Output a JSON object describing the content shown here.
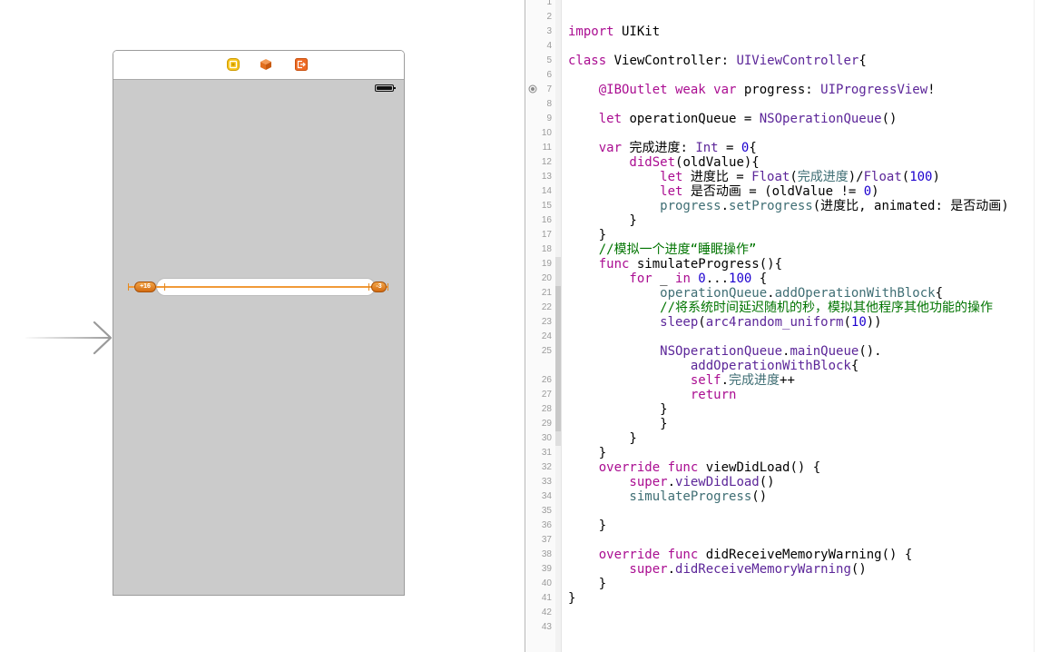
{
  "canvas": {
    "scene": {
      "dock_icons": [
        "view-controller-icon",
        "first-responder-icon",
        "exit-icon"
      ],
      "status_bar_icon": "battery-icon",
      "constraints": {
        "leading": "+16",
        "trailing": "-3"
      }
    },
    "entry_point_icon": "initial-view-controller-arrow"
  },
  "editor": {
    "outlet_indicator_icon": "outlet-connected-icon",
    "rows": [
      {
        "n": "1"
      },
      {
        "n": "2"
      },
      {
        "n": "3",
        "tk": [
          {
            "t": "import",
            "c": "#AA0D91"
          },
          {
            "t": " UIKit"
          }
        ]
      },
      {
        "n": "4"
      },
      {
        "n": "5",
        "tk": [
          {
            "t": "class",
            "c": "#AA0D91"
          },
          {
            "t": " ViewController: "
          },
          {
            "t": "UIViewController",
            "c": "#5C2699"
          },
          {
            "t": "{"
          }
        ]
      },
      {
        "n": "6"
      },
      {
        "n": "7",
        "tk": [
          {
            "t": "    @IBOutlet weak var",
            "c": "#AA0D91"
          },
          {
            "t": " progress: "
          },
          {
            "t": "UIProgressView",
            "c": "#5C2699"
          },
          {
            "t": "!"
          }
        ]
      },
      {
        "n": "8"
      },
      {
        "n": "9",
        "tk": [
          {
            "t": "    let",
            "c": "#AA0D91"
          },
          {
            "t": " operationQueue = "
          },
          {
            "t": "NSOperationQueue",
            "c": "#5C2699"
          },
          {
            "t": "()"
          }
        ]
      },
      {
        "n": "10"
      },
      {
        "n": "11",
        "tk": [
          {
            "t": "    var",
            "c": "#AA0D91"
          },
          {
            "t": " 完成进度: "
          },
          {
            "t": "Int",
            "c": "#5C2699"
          },
          {
            "t": " = "
          },
          {
            "t": "0",
            "c": "#1C00CF"
          },
          {
            "t": "{"
          }
        ]
      },
      {
        "n": "12",
        "tk": [
          {
            "t": "        didSet",
            "c": "#AA0D91"
          },
          {
            "t": "(oldValue){"
          }
        ]
      },
      {
        "n": "13",
        "tk": [
          {
            "t": "            let",
            "c": "#AA0D91"
          },
          {
            "t": " 进度比 = "
          },
          {
            "t": "Float",
            "c": "#5C2699"
          },
          {
            "t": "("
          },
          {
            "t": "完成进度",
            "c": "#3F6E74"
          },
          {
            "t": ")/"
          },
          {
            "t": "Float",
            "c": "#5C2699"
          },
          {
            "t": "("
          },
          {
            "t": "100",
            "c": "#1C00CF"
          },
          {
            "t": ")"
          }
        ]
      },
      {
        "n": "14",
        "tk": [
          {
            "t": "            let",
            "c": "#AA0D91"
          },
          {
            "t": " 是否动画 = (oldValue != "
          },
          {
            "t": "0",
            "c": "#1C00CF"
          },
          {
            "t": ")"
          }
        ]
      },
      {
        "n": "15",
        "tk": [
          {
            "t": "            progress",
            "c": "#3F6E74"
          },
          {
            "t": "."
          },
          {
            "t": "setProgress",
            "c": "#3F6E74"
          },
          {
            "t": "(进度比, animated: 是否动画)"
          }
        ]
      },
      {
        "n": "16",
        "tk": [
          {
            "t": "        }"
          }
        ]
      },
      {
        "n": "17",
        "tk": [
          {
            "t": "    }"
          }
        ]
      },
      {
        "n": "18",
        "tk": [
          {
            "t": "    //模拟一个进度“睡眠操作”",
            "c": "#007400"
          }
        ]
      },
      {
        "n": "19",
        "tk": [
          {
            "t": "    func",
            "c": "#AA0D91"
          },
          {
            "t": " simulateProgress(){"
          }
        ]
      },
      {
        "n": "20",
        "tk": [
          {
            "t": "        for",
            "c": "#AA0D91"
          },
          {
            "t": " _ "
          },
          {
            "t": "in",
            "c": "#AA0D91"
          },
          {
            "t": " 0",
            "c": "#1C00CF"
          },
          {
            "t": "..."
          },
          {
            "t": "100",
            "c": "#1C00CF"
          },
          {
            "t": " {"
          }
        ]
      },
      {
        "n": "21",
        "tk": [
          {
            "t": "            operationQueue",
            "c": "#3F6E74"
          },
          {
            "t": "."
          },
          {
            "t": "addOperationWithBlock",
            "c": "#3F6E74"
          },
          {
            "t": "{"
          }
        ]
      },
      {
        "n": "22",
        "tk": [
          {
            "t": "            //将系统时间延迟随机的秒，模拟其他程序其他功能的操作",
            "c": "#007400"
          }
        ]
      },
      {
        "n": "23",
        "tk": [
          {
            "t": "            sleep",
            "c": "#5C2699"
          },
          {
            "t": "("
          },
          {
            "t": "arc4random_uniform",
            "c": "#5C2699"
          },
          {
            "t": "("
          },
          {
            "t": "10",
            "c": "#1C00CF"
          },
          {
            "t": "))"
          }
        ]
      },
      {
        "n": "24"
      },
      {
        "n": "25",
        "tk": [
          {
            "t": "            NSOperationQueue",
            "c": "#5C2699"
          },
          {
            "t": "."
          },
          {
            "t": "mainQueue",
            "c": "#5C2699"
          },
          {
            "t": "()."
          }
        ]
      },
      {
        "tk": [
          {
            "t": "                addOperationWithBlock",
            "c": "#5C2699"
          },
          {
            "t": "{"
          }
        ]
      },
      {
        "n": "26",
        "tk": [
          {
            "t": "                self",
            "c": "#AA0D91"
          },
          {
            "t": "."
          },
          {
            "t": "完成进度",
            "c": "#3F6E74"
          },
          {
            "t": "++"
          }
        ]
      },
      {
        "n": "27",
        "tk": [
          {
            "t": "                return",
            "c": "#AA0D91"
          }
        ]
      },
      {
        "n": "28",
        "tk": [
          {
            "t": "            }"
          }
        ]
      },
      {
        "n": "29",
        "tk": [
          {
            "t": "            }"
          }
        ]
      },
      {
        "n": "30",
        "tk": [
          {
            "t": "        }"
          }
        ]
      },
      {
        "n": "31",
        "tk": [
          {
            "t": "    }"
          }
        ]
      },
      {
        "n": "32",
        "tk": [
          {
            "t": "    override func",
            "c": "#AA0D91"
          },
          {
            "t": " viewDidLoad() {"
          }
        ]
      },
      {
        "n": "33",
        "tk": [
          {
            "t": "        super",
            "c": "#AA0D91"
          },
          {
            "t": "."
          },
          {
            "t": "viewDidLoad",
            "c": "#5C2699"
          },
          {
            "t": "()"
          }
        ]
      },
      {
        "n": "34",
        "tk": [
          {
            "t": "        simulateProgress",
            "c": "#3F6E74"
          },
          {
            "t": "()"
          }
        ]
      },
      {
        "n": "35"
      },
      {
        "n": "36",
        "tk": [
          {
            "t": "    }"
          }
        ]
      },
      {
        "n": "37"
      },
      {
        "n": "38",
        "tk": [
          {
            "t": "    override func",
            "c": "#AA0D91"
          },
          {
            "t": " didReceiveMemoryWarning() {"
          }
        ]
      },
      {
        "n": "39",
        "tk": [
          {
            "t": "        super",
            "c": "#AA0D91"
          },
          {
            "t": "."
          },
          {
            "t": "didReceiveMemoryWarning",
            "c": "#5C2699"
          },
          {
            "t": "()"
          }
        ]
      },
      {
        "n": "40",
        "tk": [
          {
            "t": "    }"
          }
        ]
      },
      {
        "n": "41",
        "tk": [
          {
            "t": "}"
          }
        ]
      },
      {
        "n": "42"
      },
      {
        "n": "43"
      }
    ]
  }
}
